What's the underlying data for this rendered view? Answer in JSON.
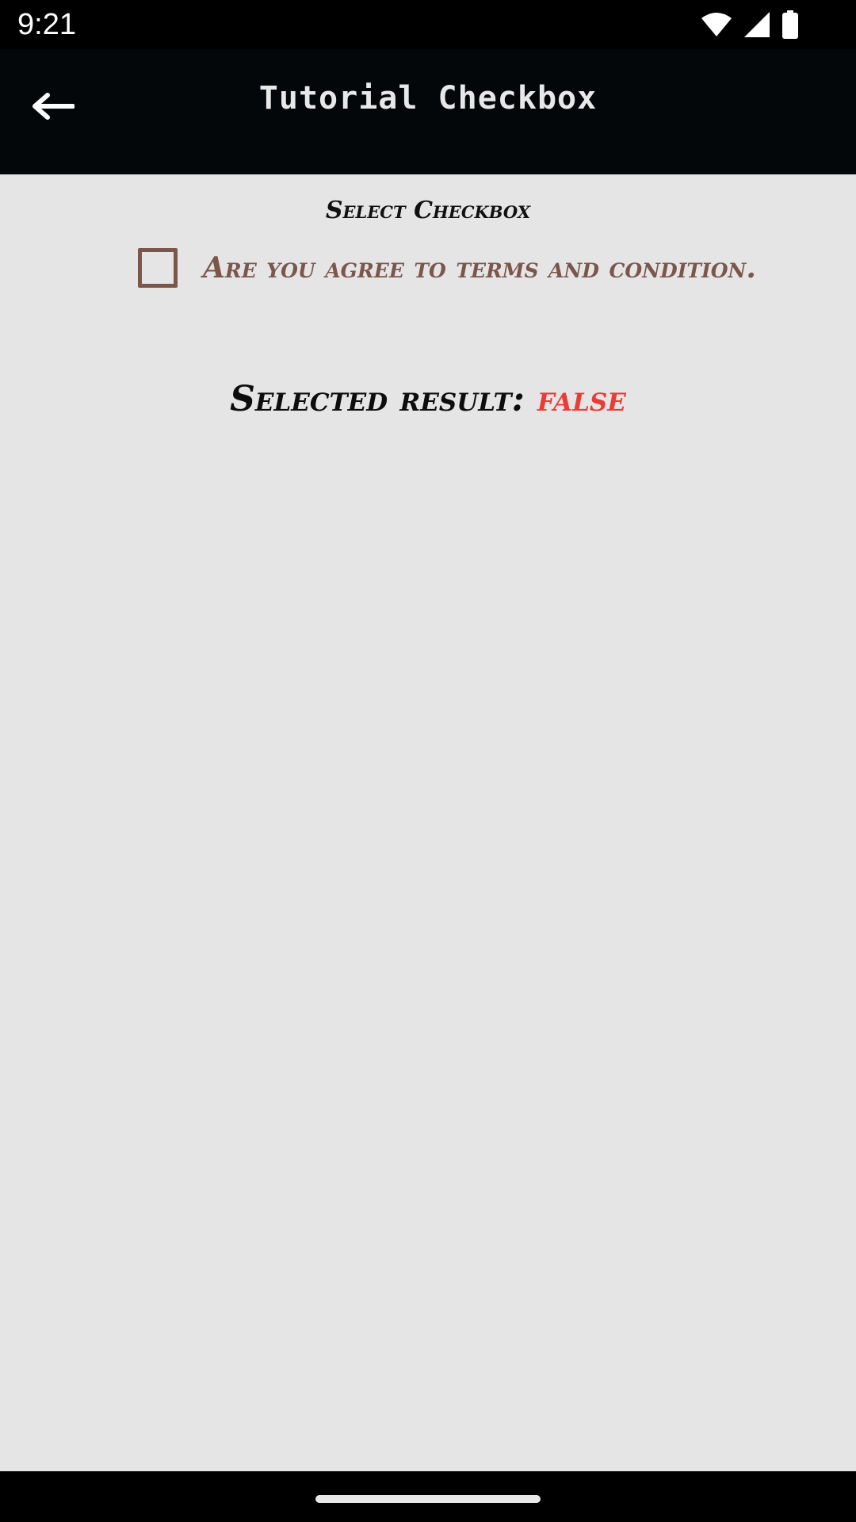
{
  "status_bar": {
    "time": "9:21",
    "icons": [
      "wifi-icon",
      "cellular-signal-icon",
      "battery-icon"
    ]
  },
  "app_bar": {
    "title": "Tutorial Checkbox",
    "back_icon": "arrow-left-icon"
  },
  "content": {
    "section_label": "Select Checkbox",
    "checkbox": {
      "label": "Are you agree to terms and condition.",
      "checked": false
    },
    "result": {
      "label": "Selected result:",
      "value": "false"
    }
  },
  "colors": {
    "app_bar_background": "#04070a",
    "screen_background": "#e6e5e6",
    "checkbox_color": "#7a564b",
    "result_false_color": "#ec3b34"
  }
}
